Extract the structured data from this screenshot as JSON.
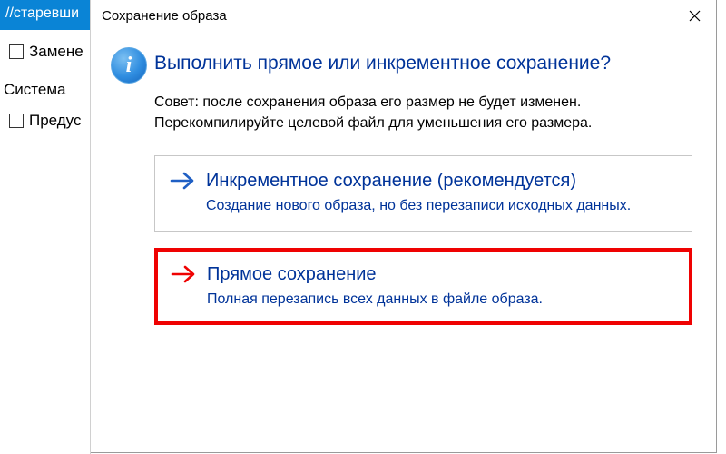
{
  "background": {
    "tab_label": "/старевши",
    "checkbox1_label": "Замене",
    "section_heading": "Система",
    "checkbox2_label": "Предус"
  },
  "dialog": {
    "title": "Сохранение образа",
    "info_glyph": "i",
    "question": "Выполнить прямое или инкрементное сохранение?",
    "tip": "Совет: после сохранения образа его размер не будет изменен. Перекомпилируйте целевой файл для уменьшения его размера.",
    "options": [
      {
        "title": "Инкрементное сохранение (рекомендуется)",
        "desc": "Создание нового образа, но без перезаписи исходных данных."
      },
      {
        "title": "Прямое сохранение",
        "desc": "Полная перезапись всех данных в файле образа."
      }
    ]
  },
  "colors": {
    "tab_bg": "#0a84d6",
    "link_blue": "#003399",
    "highlight_red": "#ef0202"
  }
}
